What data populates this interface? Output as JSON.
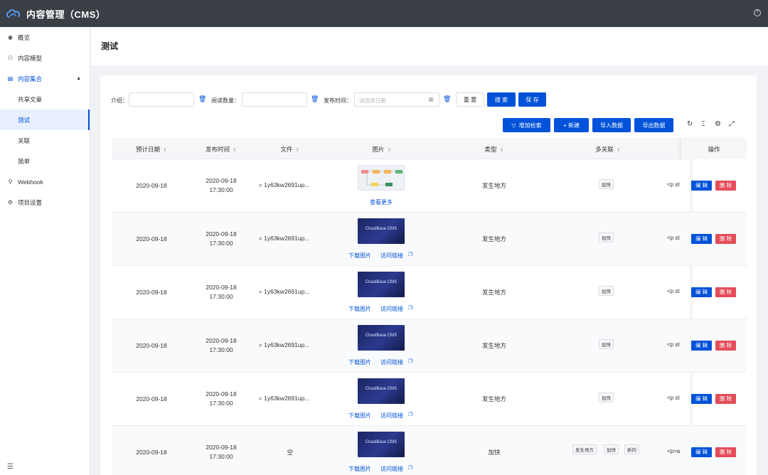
{
  "app": {
    "title": "内容管理（CMS）"
  },
  "sidebar": {
    "items": [
      {
        "label": "概览"
      },
      {
        "label": "内容模型"
      },
      {
        "label": "内容集合"
      },
      {
        "label": "共享文章"
      },
      {
        "label": "测试"
      },
      {
        "label": "关联"
      },
      {
        "label": "简单"
      },
      {
        "label": "Webhook"
      },
      {
        "label": "项目设置"
      }
    ]
  },
  "header": {
    "title": "测试"
  },
  "filters": {
    "intro_label": "介绍：",
    "reads_label": "阅读数量：",
    "publish_label": "发布时间：",
    "date_placeholder": "请选择日期",
    "reset": "重 置",
    "search": "搜 索",
    "save": "保 存"
  },
  "toolbar": {
    "add_filter": "增加检索",
    "new": "+ 新建",
    "import": "导入数据",
    "export": "导出数据"
  },
  "table": {
    "columns": [
      "预计日期",
      "发布时间",
      "文件",
      "图片",
      "类型",
      "多关联",
      "操作"
    ],
    "rows": [
      {
        "date": "2020-09-18",
        "pub_date": "2020-09-18",
        "pub_time": "17:30:00",
        "file": "1y63kw2691up...",
        "link1": "查看更多",
        "link2": "",
        "type": "发生地方",
        "tags": [
          "加快"
        ],
        "ptext": "<p st"
      },
      {
        "date": "2020-09-18",
        "pub_date": "2020-09-18",
        "pub_time": "17:30:00",
        "file": "1y63kw2691up...",
        "link1": "下载图片",
        "link2": "访问链接",
        "type": "发生地方",
        "tags": [
          "加快"
        ],
        "ptext": "<p st"
      },
      {
        "date": "2020-09-18",
        "pub_date": "2020-09-18",
        "pub_time": "17:30:00",
        "file": "1y63kw2691up...",
        "link1": "下载图片",
        "link2": "访问链接",
        "type": "发生地方",
        "tags": [
          "加快"
        ],
        "ptext": "<p st"
      },
      {
        "date": "2020-09-18",
        "pub_date": "2020-09-18",
        "pub_time": "17:30:00",
        "file": "1y63kw2691up...",
        "link1": "下载图片",
        "link2": "访问链接",
        "type": "发生地方",
        "tags": [
          "加快"
        ],
        "ptext": "<p st"
      },
      {
        "date": "2020-09-18",
        "pub_date": "2020-09-18",
        "pub_time": "17:30:00",
        "file": "1y63kw2691up...",
        "link1": "下载图片",
        "link2": "访问链接",
        "type": "发生地方",
        "tags": [
          "加快"
        ],
        "ptext": "<p st"
      },
      {
        "date": "2020-09-18",
        "pub_date": "2020-09-18",
        "pub_time": "17:30:00",
        "file": "空",
        "link1": "下载图片",
        "link2": "访问链接",
        "type": "加快",
        "tags": [
          "发生地方",
          "加快",
          "新的"
        ],
        "ptext": "<p>a"
      }
    ],
    "edit_label": "编 辑",
    "delete_label": "删 除",
    "thumb_text": "CloudBase CMS"
  }
}
